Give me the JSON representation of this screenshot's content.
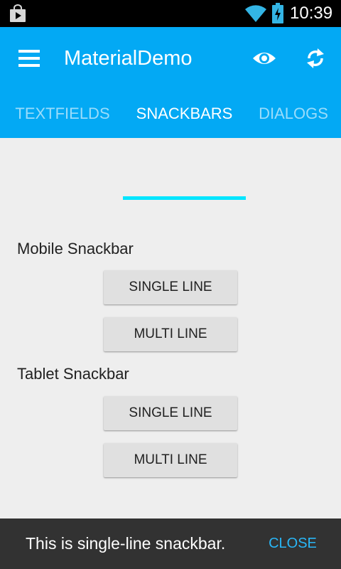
{
  "status_bar": {
    "time": "10:39",
    "icons": [
      "store-icon",
      "wifi-icon",
      "battery-charging-icon"
    ]
  },
  "toolbar": {
    "title": "MaterialDemo",
    "icons": [
      "menu-icon",
      "eye-icon",
      "refresh-icon"
    ]
  },
  "tabs": [
    {
      "label": "TEXTFIELDS",
      "active": false
    },
    {
      "label": "SNACKBARS",
      "active": true
    },
    {
      "label": "DIALOGS",
      "active": false
    }
  ],
  "sections": [
    {
      "label": "Mobile Snackbar",
      "buttons": [
        "SINGLE LINE",
        "MULTI LINE"
      ]
    },
    {
      "label": "Tablet Snackbar",
      "buttons": [
        "SINGLE LINE",
        "MULTI LINE"
      ]
    }
  ],
  "snackbar": {
    "message": "This is single-line snackbar.",
    "action": "CLOSE"
  },
  "colors": {
    "primary": "#03a9f4",
    "tab_indicator": "#00e5ff",
    "background": "#eeeeee",
    "snackbar": "#323232",
    "snackbar_action": "#29b6f6"
  }
}
